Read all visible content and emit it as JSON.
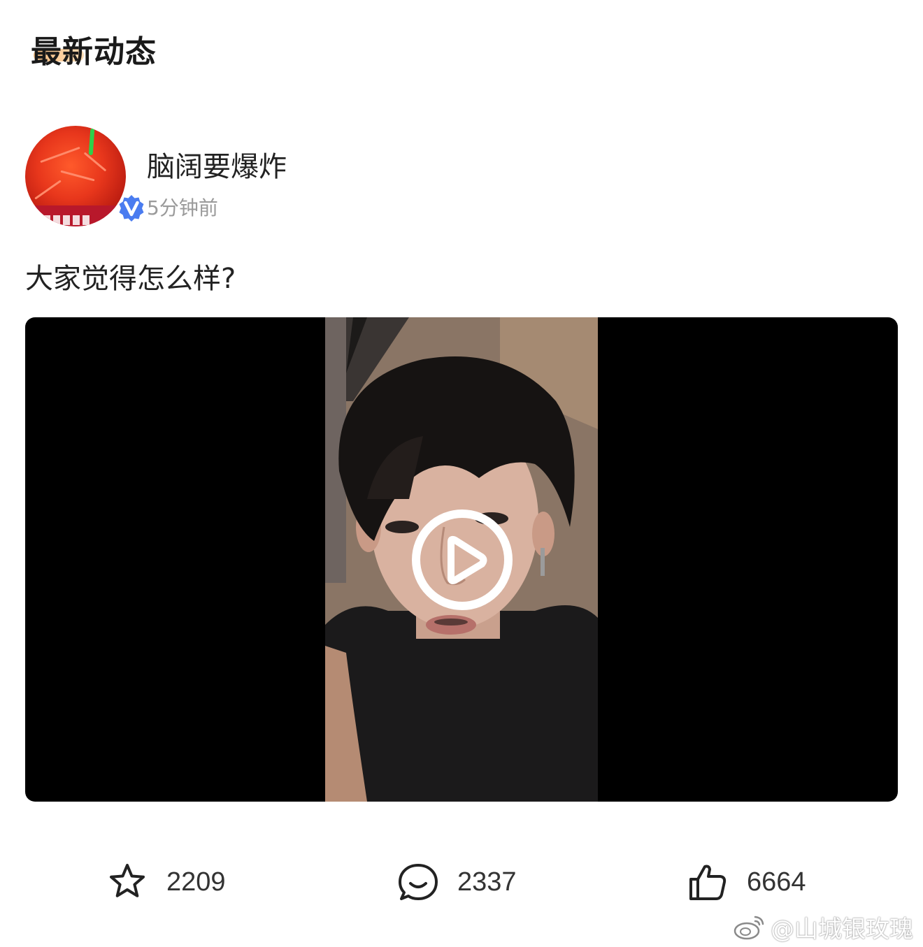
{
  "section": {
    "title": "最新动态"
  },
  "post": {
    "author": {
      "name": "脑阔要爆炸",
      "verified_badge_letter": "V",
      "badge_color": "#4a7cf0"
    },
    "time": "5分钟前",
    "text": "大家觉得怎么样?",
    "video": {
      "play_icon": "play-icon"
    },
    "actions": {
      "favorite": {
        "icon": "star-icon",
        "count": "2209"
      },
      "comment": {
        "icon": "comment-bubble-icon",
        "count": "2337"
      },
      "like": {
        "icon": "thumbs-up-icon",
        "count": "6664"
      }
    }
  },
  "watermark": {
    "text": "@山城银玫瑰"
  }
}
